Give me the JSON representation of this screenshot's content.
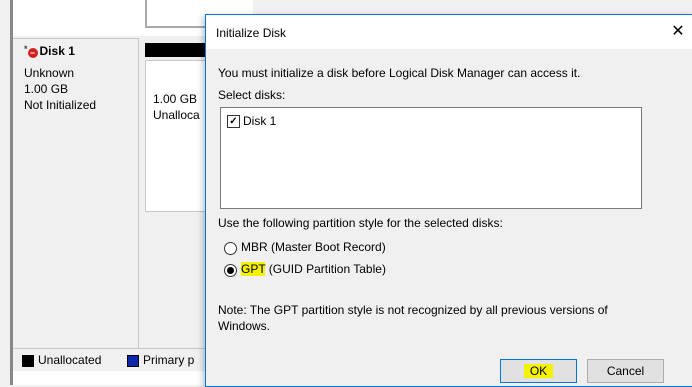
{
  "background": {
    "disk": {
      "name": "Disk 1",
      "type": "Unknown",
      "size": "1.00 GB",
      "status": "Not Initialized"
    },
    "partition": {
      "size": "1.00 GB",
      "label": "Unalloca"
    },
    "legend": [
      {
        "label": "Unallocated",
        "color": "#000000"
      },
      {
        "label": "Primary p",
        "color": "#0c28a8"
      }
    ]
  },
  "dialog": {
    "title": "Initialize Disk",
    "close_glyph": "✕",
    "instruction": "You must initialize a disk before Logical Disk Manager can access it.",
    "select_label": "Select disks:",
    "disks": [
      {
        "label": "Disk 1",
        "checked": true
      }
    ],
    "partition_prompt": "Use the following partition style for the selected disks:",
    "options": [
      {
        "label": "MBR (Master Boot Record)",
        "selected": false
      },
      {
        "label_highlight": "GPT",
        "label_rest": " (GUID Partition Table)",
        "selected": true
      }
    ],
    "note_line1": "Note: The GPT partition style is not recognized by all previous versions of",
    "note_line2": "Windows.",
    "ok_label": "OK",
    "cancel_label": "Cancel",
    "accent_color": "#0078d7",
    "highlight_color": "#f5f200"
  }
}
